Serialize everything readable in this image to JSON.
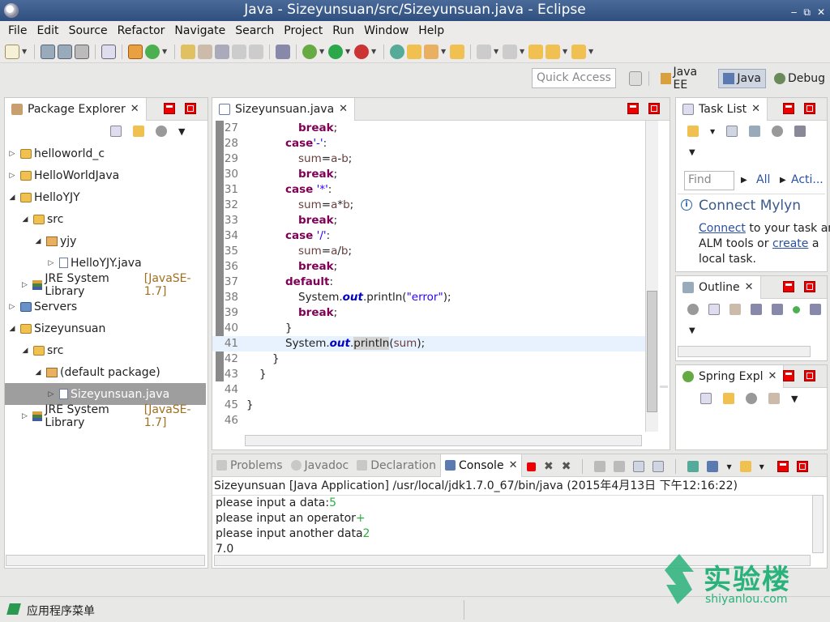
{
  "window": {
    "title": "Java - Sizeyunsuan/src/Sizeyunsuan.java - Eclipse",
    "controls": [
      "‒",
      "⧉",
      "✕"
    ]
  },
  "menu": [
    "File",
    "Edit",
    "Source",
    "Refactor",
    "Navigate",
    "Search",
    "Project",
    "Run",
    "Window",
    "Help"
  ],
  "quick_access": {
    "placeholder": "Quick Access"
  },
  "perspectives": [
    {
      "label": "Java EE",
      "active": false
    },
    {
      "label": "Java",
      "active": true
    },
    {
      "label": "Debug",
      "active": false
    }
  ],
  "package_explorer": {
    "title": "Package Explorer",
    "rows": [
      {
        "label": "helloworld_c",
        "depth": 0,
        "icon": "project",
        "expanded": false
      },
      {
        "label": "HelloWorldJava",
        "depth": 0,
        "icon": "project",
        "expanded": false
      },
      {
        "label": "HelloYJY",
        "depth": 0,
        "icon": "project",
        "expanded": true
      },
      {
        "label": "src",
        "depth": 1,
        "icon": "src-folder",
        "expanded": true
      },
      {
        "label": "yjy",
        "depth": 2,
        "icon": "package",
        "expanded": true
      },
      {
        "label": "HelloYJY.java",
        "depth": 3,
        "icon": "java-file",
        "expanded": false
      },
      {
        "label": "JRE System Library",
        "extra": "[JavaSE-1.7]",
        "depth": 1,
        "icon": "library",
        "expanded": false
      },
      {
        "label": "Servers",
        "depth": 0,
        "icon": "project",
        "expanded": false
      },
      {
        "label": "Sizeyunsuan",
        "depth": 0,
        "icon": "project",
        "expanded": true
      },
      {
        "label": "src",
        "depth": 1,
        "icon": "src-folder",
        "expanded": true
      },
      {
        "label": "(default package)",
        "depth": 2,
        "icon": "package",
        "expanded": true
      },
      {
        "label": "Sizeyunsuan.java",
        "depth": 3,
        "icon": "java-file",
        "expanded": false,
        "selected": true
      },
      {
        "label": "JRE System Library",
        "extra": "[JavaSE-1.7]",
        "depth": 1,
        "icon": "library",
        "expanded": false
      }
    ]
  },
  "editor": {
    "tab": "Sizeyunsuan.java",
    "lines": [
      {
        "n": "27",
        "indent": 4,
        "parts": [
          [
            "kw",
            "break"
          ],
          [
            "",
            ";"
          ]
        ]
      },
      {
        "n": "28",
        "indent": 3,
        "parts": [
          [
            "kw",
            "case"
          ],
          [
            "str",
            "'-'"
          ],
          [
            "",
            ":"
          ]
        ]
      },
      {
        "n": "29",
        "indent": 4,
        "parts": [
          [
            "var",
            "sum"
          ],
          [
            "",
            "="
          ],
          [
            "var",
            "a"
          ],
          [
            "",
            "-"
          ],
          [
            "var",
            "b"
          ],
          [
            "",
            ";"
          ]
        ]
      },
      {
        "n": "30",
        "indent": 4,
        "parts": [
          [
            "kw",
            "break"
          ],
          [
            "",
            ";"
          ]
        ]
      },
      {
        "n": "31",
        "indent": 3,
        "parts": [
          [
            "kw",
            "case"
          ],
          [
            "",
            " "
          ],
          [
            "str",
            "'*'"
          ],
          [
            "",
            ":"
          ]
        ]
      },
      {
        "n": "32",
        "indent": 4,
        "parts": [
          [
            "var",
            "sum"
          ],
          [
            "",
            "="
          ],
          [
            "var",
            "a"
          ],
          [
            "",
            "*"
          ],
          [
            "var",
            "b"
          ],
          [
            "",
            ";"
          ]
        ]
      },
      {
        "n": "33",
        "indent": 4,
        "parts": [
          [
            "kw",
            "break"
          ],
          [
            "",
            ";"
          ]
        ]
      },
      {
        "n": "34",
        "indent": 3,
        "parts": [
          [
            "kw",
            "case"
          ],
          [
            "",
            " "
          ],
          [
            "str",
            "'/'"
          ],
          [
            "",
            ":"
          ]
        ]
      },
      {
        "n": "35",
        "indent": 4,
        "parts": [
          [
            "var",
            "sum"
          ],
          [
            "",
            "="
          ],
          [
            "var",
            "a"
          ],
          [
            "",
            "/"
          ],
          [
            "var",
            "b"
          ],
          [
            "",
            ";"
          ]
        ]
      },
      {
        "n": "36",
        "indent": 4,
        "parts": [
          [
            "kw",
            "break"
          ],
          [
            "",
            ";"
          ]
        ]
      },
      {
        "n": "37",
        "indent": 3,
        "parts": [
          [
            "kw",
            "default"
          ],
          [
            "",
            ":"
          ]
        ]
      },
      {
        "n": "38",
        "indent": 4,
        "parts": [
          [
            "",
            "System."
          ],
          [
            "fld",
            "out"
          ],
          [
            "",
            ".println("
          ],
          [
            "str",
            "\"error\""
          ],
          [
            "",
            ");"
          ]
        ]
      },
      {
        "n": "39",
        "indent": 4,
        "parts": [
          [
            "kw",
            "break"
          ],
          [
            "",
            ";"
          ]
        ]
      },
      {
        "n": "40",
        "indent": 3,
        "parts": [
          [
            "",
            "}"
          ]
        ]
      },
      {
        "n": "41",
        "indent": 3,
        "hl": true,
        "parts": [
          [
            "",
            "System."
          ],
          [
            "fld",
            "out"
          ],
          [
            "",
            "."
          ],
          [
            "mhl",
            "println"
          ],
          [
            "",
            "("
          ],
          [
            "var",
            "sum"
          ],
          [
            "",
            ");"
          ]
        ]
      },
      {
        "n": "42",
        "indent": 2,
        "parts": [
          [
            "",
            "}"
          ]
        ]
      },
      {
        "n": "43",
        "indent": 1,
        "parts": [
          [
            "",
            "}"
          ]
        ]
      },
      {
        "n": "44",
        "indent": 0,
        "parts": []
      },
      {
        "n": "45",
        "indent": 0,
        "parts": [
          [
            "",
            "}"
          ]
        ]
      },
      {
        "n": "46",
        "indent": 0,
        "parts": []
      }
    ]
  },
  "task_list": {
    "title": "Task List",
    "find_placeholder": "Find",
    "filter_all": "All",
    "filter_acti": "Acti...",
    "mylyn_title": "Connect Mylyn",
    "mylyn_connect": "Connect",
    "mylyn_text1": " to your task and",
    "mylyn_text2": "ALM tools or ",
    "mylyn_create": "create",
    "mylyn_text3": " a",
    "mylyn_text4": "local task."
  },
  "outline": {
    "title": "Outline"
  },
  "spring": {
    "title": "Spring Expl"
  },
  "console": {
    "tabs": [
      "Problems",
      "Javadoc",
      "Declaration",
      "Console"
    ],
    "header": "Sizeyunsuan [Java Application] /usr/local/jdk1.7.0_67/bin/java (2015年4月13日 下午12:16:22)",
    "lines": [
      {
        "text": "please input a data:",
        "input": "5"
      },
      {
        "text": "please input an operator",
        "input": "+"
      },
      {
        "text": "please input another data",
        "input": "2"
      },
      {
        "text": "7.0",
        "input": ""
      }
    ]
  },
  "status": {
    "app_menu": "应用程序菜单"
  },
  "watermark": {
    "cn": "实验楼",
    "domain": "shiyanlou.com"
  },
  "colors": {
    "titlebar": "#3a5a8c",
    "keyword": "#7f0055",
    "string": "#2a00ff",
    "selection": "#9e9e9e",
    "close_red": "#e00000",
    "watermark_green": "#27ae60"
  }
}
